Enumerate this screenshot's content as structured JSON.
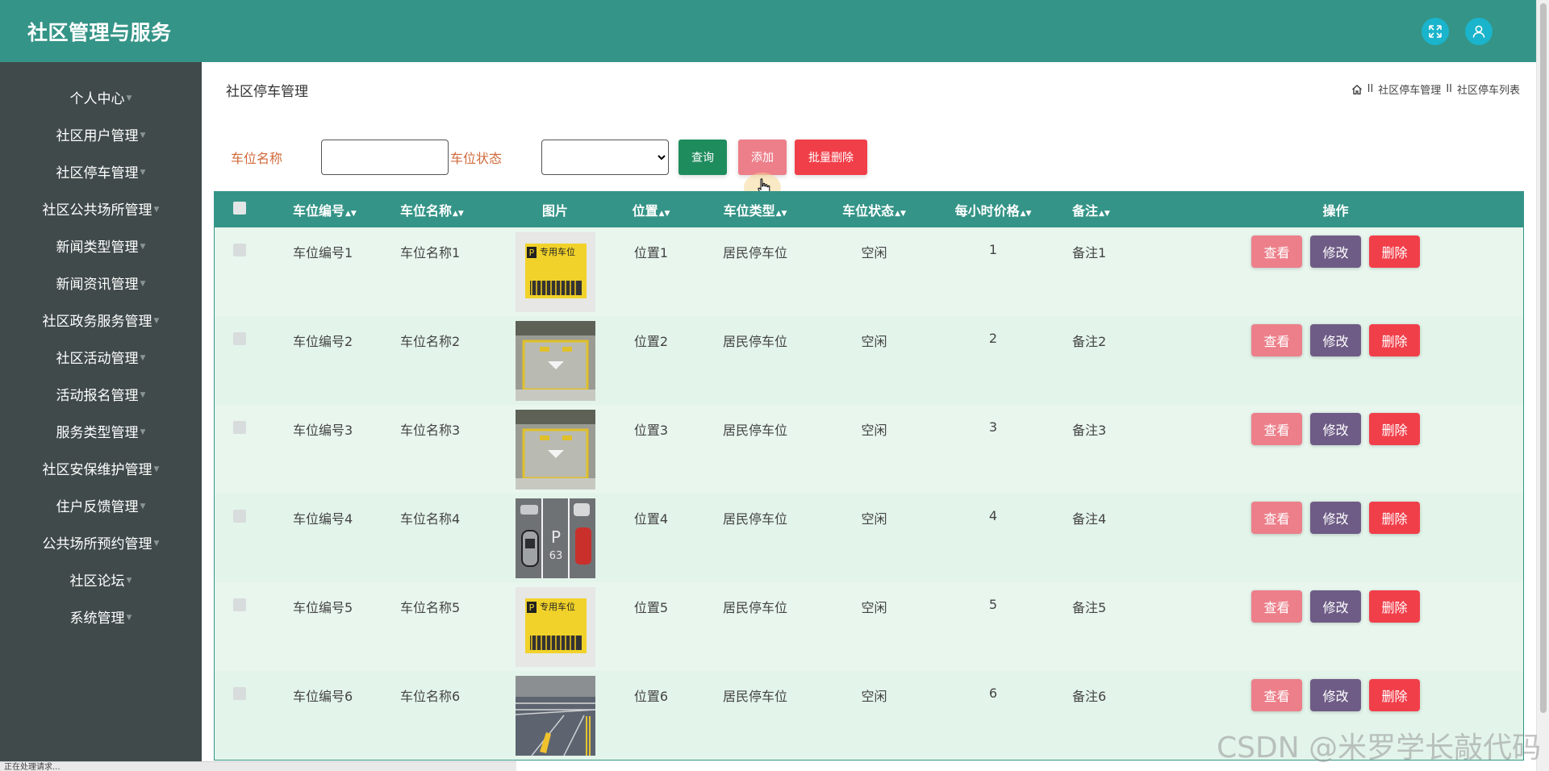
{
  "app": {
    "title": "社区管理与服务"
  },
  "sidebar": {
    "items": [
      {
        "label": "个人中心"
      },
      {
        "label": "社区用户管理"
      },
      {
        "label": "社区停车管理"
      },
      {
        "label": "社区公共场所管理"
      },
      {
        "label": "新闻类型管理"
      },
      {
        "label": "新闻资讯管理"
      },
      {
        "label": "社区政务服务管理"
      },
      {
        "label": "社区活动管理"
      },
      {
        "label": "活动报名管理"
      },
      {
        "label": "服务类型管理"
      },
      {
        "label": "社区安保维护管理"
      },
      {
        "label": "住户反馈管理"
      },
      {
        "label": "公共场所预约管理"
      },
      {
        "label": "社区论坛"
      },
      {
        "label": "系统管理"
      }
    ]
  },
  "page": {
    "title": "社区停车管理",
    "breadcrumb": {
      "sep": "II",
      "level1": "社区停车管理",
      "level2": "社区停车列表"
    }
  },
  "search": {
    "name_label": "车位名称",
    "name_value": "",
    "status_label": "车位状态",
    "status_value": "",
    "query_label": "查询",
    "add_label": "添加",
    "batch_delete_label": "批量删除"
  },
  "table": {
    "headers": {
      "code": "车位编号",
      "name": "车位名称",
      "image": "图片",
      "location": "位置",
      "type": "车位类型",
      "status": "车位状态",
      "price": "每小时价格",
      "note": "备注",
      "ops": "操作"
    },
    "op_labels": {
      "view": "查看",
      "edit": "修改",
      "delete": "删除"
    },
    "rows": [
      {
        "code": "车位编号1",
        "name": "车位名称1",
        "image": "sign",
        "location": "位置1",
        "type": "居民停车位",
        "status": "空闲",
        "price": "1",
        "note": "备注1"
      },
      {
        "code": "车位编号2",
        "name": "车位名称2",
        "image": "lot",
        "location": "位置2",
        "type": "居民停车位",
        "status": "空闲",
        "price": "2",
        "note": "备注2"
      },
      {
        "code": "车位编号3",
        "name": "车位名称3",
        "image": "lot",
        "location": "位置3",
        "type": "居民停车位",
        "status": "空闲",
        "price": "3",
        "note": "备注3"
      },
      {
        "code": "车位编号4",
        "name": "车位名称4",
        "image": "cars",
        "location": "位置4",
        "type": "居民停车位",
        "status": "空闲",
        "price": "4",
        "note": "备注4"
      },
      {
        "code": "车位编号5",
        "name": "车位名称5",
        "image": "sign",
        "location": "位置5",
        "type": "居民停车位",
        "status": "空闲",
        "price": "5",
        "note": "备注5"
      },
      {
        "code": "车位编号6",
        "name": "车位名称6",
        "image": "street",
        "location": "位置6",
        "type": "居民停车位",
        "status": "空闲",
        "price": "6",
        "note": "备注6"
      }
    ]
  },
  "status_bar": {
    "text": "正在处理请求..."
  },
  "watermark": {
    "text": "CSDN @米罗学长敲代码"
  },
  "colors": {
    "header": "#349487",
    "sidebar": "#404a4a",
    "view": "#ec7f8a",
    "edit": "#6e5c86",
    "delete": "#f13f4a",
    "query": "#1f8c5e"
  }
}
